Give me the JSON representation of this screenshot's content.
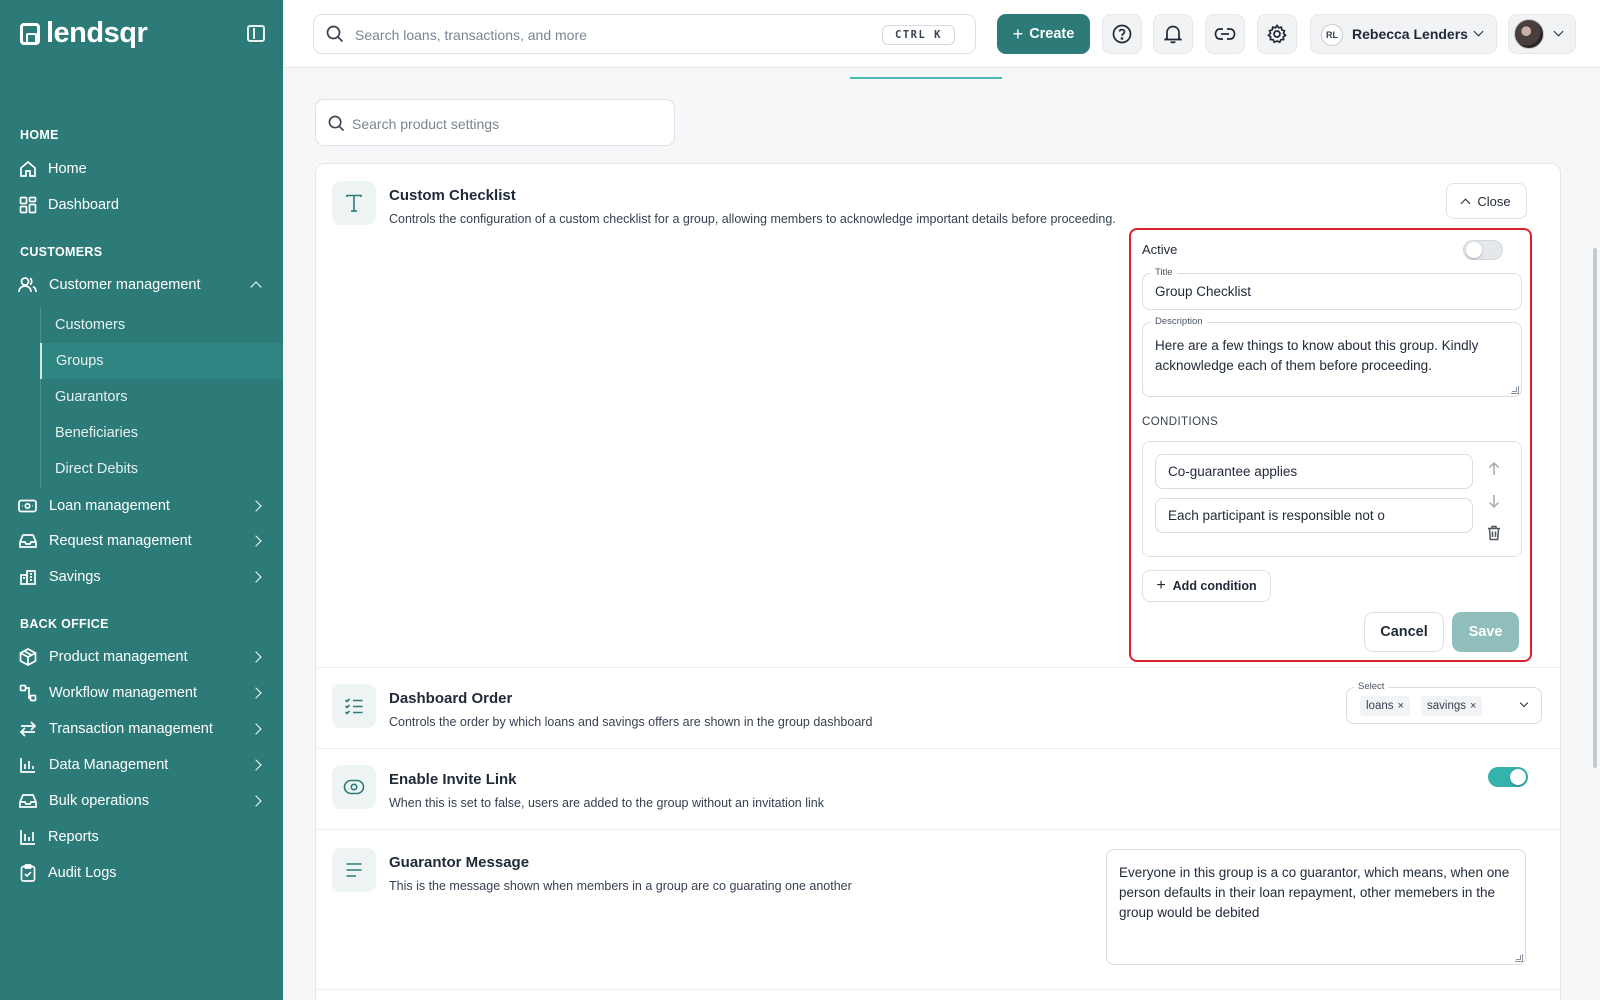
{
  "sidebar": {
    "brand": "lendsqr",
    "sections": {
      "home": "HOME",
      "customers": "CUSTOMERS",
      "back_office": "BACK OFFICE"
    },
    "items": {
      "home": "Home",
      "dashboard": "Dashboard",
      "customer_management": "Customer management",
      "customers": "Customers",
      "groups": "Groups",
      "guarantors": "Guarantors",
      "beneficiaries": "Beneficiaries",
      "direct_debits": "Direct Debits",
      "loan_management": "Loan management",
      "request_management": "Request management",
      "savings": "Savings",
      "product_management": "Product management",
      "workflow_management": "Workflow management",
      "transaction_management": "Transaction management",
      "data_management": "Data Management",
      "bulk_operations": "Bulk operations",
      "reports": "Reports",
      "audit_logs": "Audit Logs"
    }
  },
  "header": {
    "search_placeholder": "Search loans, transactions, and more",
    "shortcut": "CTRL K",
    "create_label": "Create",
    "org_initials": "RL",
    "org_name": "Rebecca Lenders"
  },
  "main": {
    "settings_search_placeholder": "Search product settings",
    "custom_checklist": {
      "title": "Custom Checklist",
      "description": "Controls the configuration of a custom checklist for a group, allowing members to acknowledge important details before proceeding.",
      "close_label": "Close",
      "editor": {
        "active_label": "Active",
        "active": false,
        "title_legend": "Title",
        "title_value": "Group Checklist",
        "description_legend": "Description",
        "description_value": "Here are a few things to know about this group. Kindly acknowledge each of them before proceeding.",
        "conditions_label": "CONDITIONS",
        "conditions": [
          "Co-guarantee applies",
          "Each participant is responsible not o"
        ],
        "add_condition_label": "Add condition",
        "cancel_label": "Cancel",
        "save_label": "Save"
      }
    },
    "dashboard_order": {
      "title": "Dashboard Order",
      "description": "Controls the order by which loans and savings offers are shown in the group dashboard",
      "select_legend": "Select",
      "chips": [
        "loans",
        "savings"
      ],
      "chip_remove": "×"
    },
    "invite_link": {
      "title": "Enable Invite Link",
      "description": "When this is set to false, users are added to the group without an invitation link",
      "enabled": true
    },
    "guarantor_message": {
      "title": "Guarantor Message",
      "description": "This is the message shown when members in a group are co guarating one another",
      "value": "Everyone in this group is a co guarantor, which means, when one person defaults in their loan repayment, other memebers in the group would be debited"
    }
  },
  "colors": {
    "brand": "#2c7b78",
    "highlight_border": "#d9222c",
    "toggle_on": "#36b2ac",
    "save_disabled": "#8fbebc"
  }
}
